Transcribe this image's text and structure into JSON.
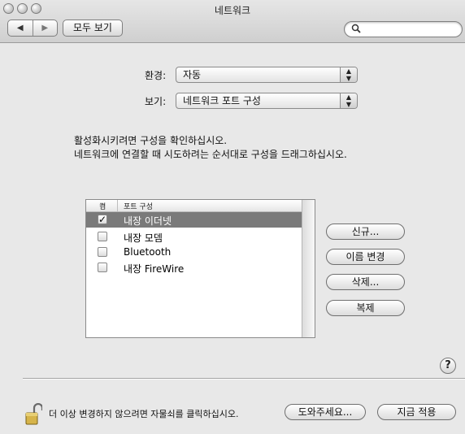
{
  "window": {
    "title": "네트워크"
  },
  "toolbar": {
    "back_icon": "left-arrow-icon",
    "forward_icon": "right-arrow-icon",
    "show_all_label": "모두 보기",
    "search_placeholder": ""
  },
  "form": {
    "location_label": "환경:",
    "location_value": "자동",
    "show_label": "보기:",
    "show_value": "네트워크 포트 구성"
  },
  "description": {
    "line1": "활성화시키려면 구성을 확인하십시오.",
    "line2": "네트워크에 연결할 때 시도하려는 순서대로 구성을 드래그하십시오."
  },
  "table": {
    "headers": {
      "on": "켬",
      "port": "포트 구성"
    },
    "rows": [
      {
        "label": "내장 이더넷",
        "checked": true,
        "selected": true
      },
      {
        "label": "내장 모뎀",
        "checked": false,
        "selected": false
      },
      {
        "label": "Bluetooth",
        "checked": false,
        "selected": false
      },
      {
        "label": "내장 FireWire",
        "checked": false,
        "selected": false
      }
    ]
  },
  "buttons": {
    "new": "신규...",
    "rename": "이름 변경",
    "delete": "삭제...",
    "duplicate": "복제"
  },
  "help": {
    "label": "?"
  },
  "footer": {
    "lock_text": "더 이상 변경하지 않으려면 자물쇠를 클릭하십시오.",
    "assist_label": "도와주세요...",
    "apply_label": "지금 적용"
  }
}
